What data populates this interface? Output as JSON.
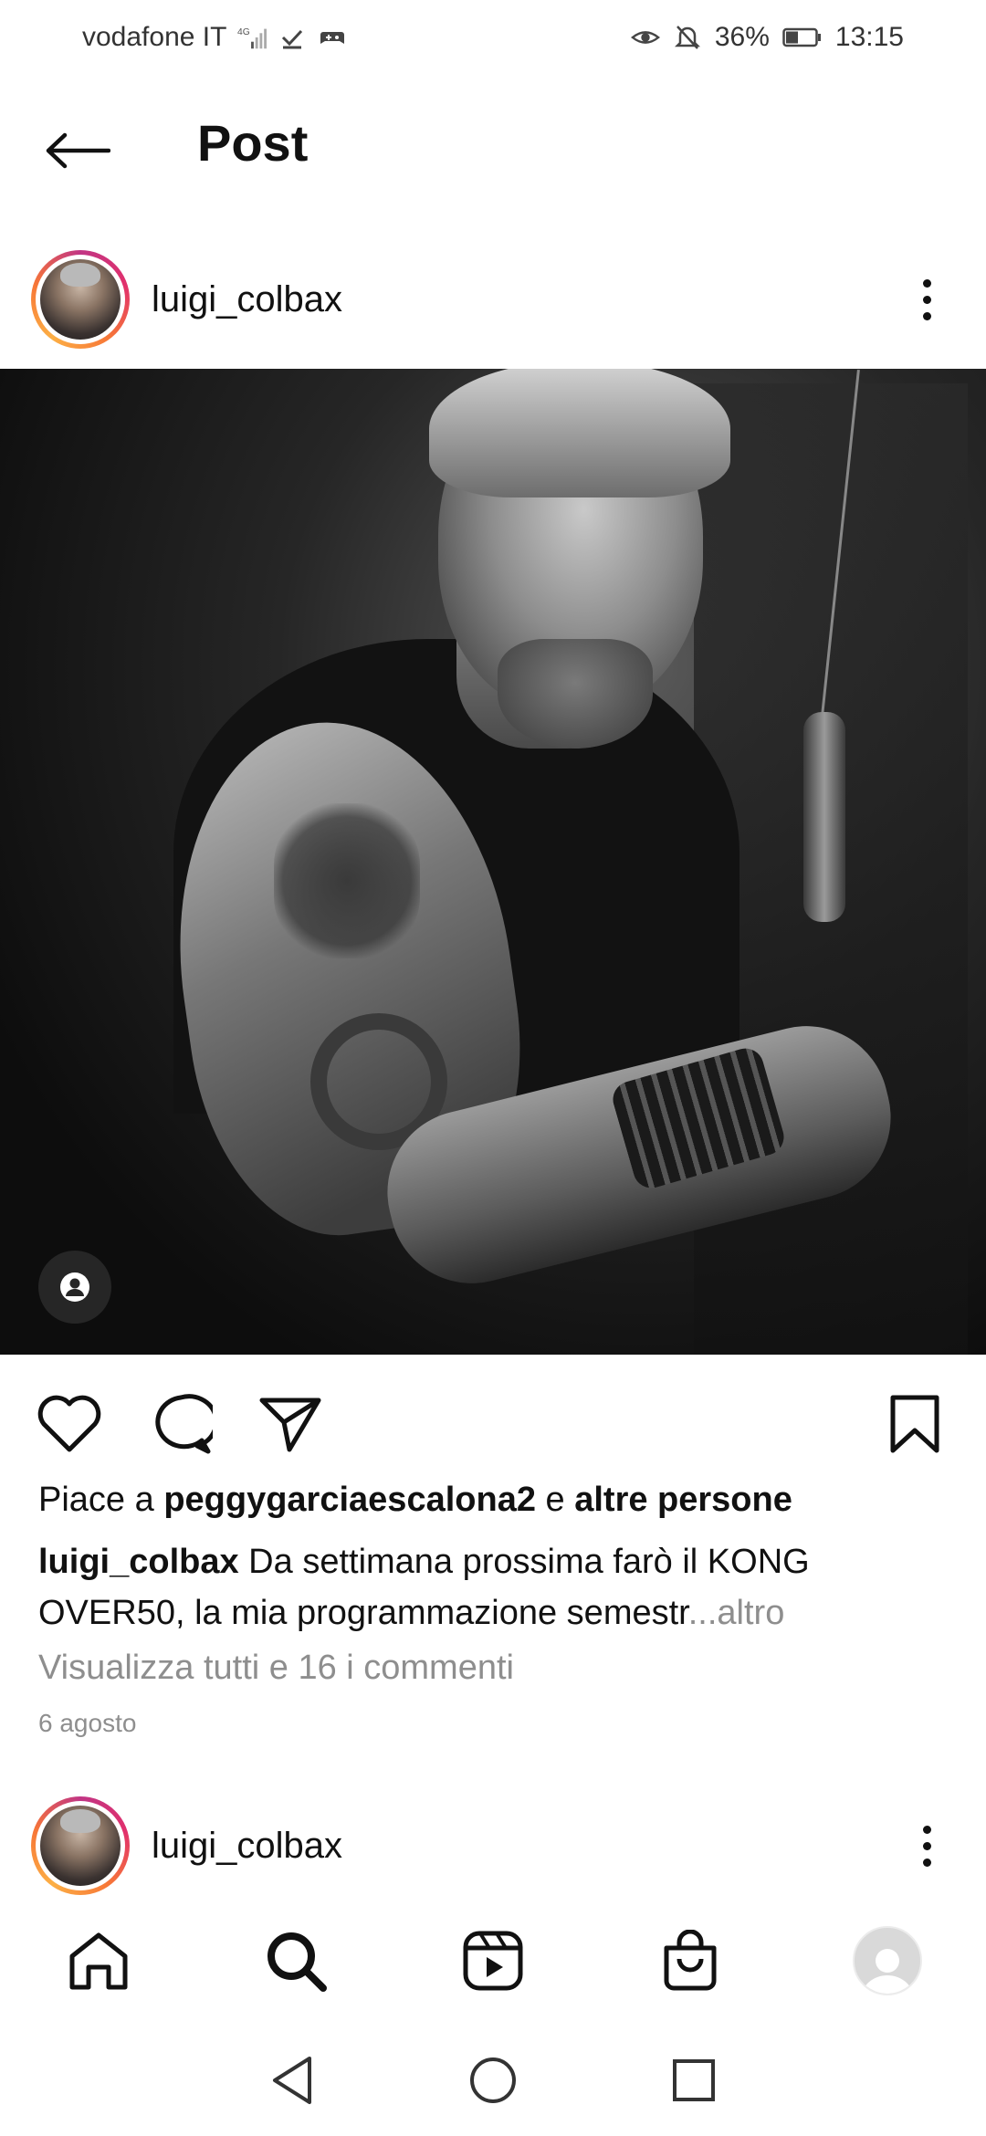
{
  "status_bar": {
    "carrier": "vodafone IT",
    "network": "4G",
    "battery": "36%",
    "time": "13:15",
    "icons": [
      "signal-icon",
      "check-icon",
      "game-icon",
      "eye-icon",
      "bell-off-icon",
      "battery-icon"
    ]
  },
  "header": {
    "title": "Post"
  },
  "post": {
    "username": "luigi_colbax",
    "likes": {
      "prefix": "Piace a ",
      "liker": "peggygarciaescalona2",
      "conjunction": " e ",
      "others": "altre persone"
    },
    "caption": {
      "username": "luigi_colbax",
      "text": " Da settimana prossima farò il KONG OVER50, la mia programmazione semestr",
      "more": "...altro"
    },
    "view_comments": "Visualizza tutti e 16 i commenti",
    "date": "6 agosto"
  },
  "next_post": {
    "username": "luigi_colbax"
  },
  "bottom_nav": [
    "home-icon",
    "search-icon",
    "reels-icon",
    "shop-icon",
    "profile-avatar"
  ],
  "colors": {
    "text": "#111111",
    "secondary": "#8e8e8e",
    "story_ring": [
      "#c13584",
      "#e1306c",
      "#f77737",
      "#fcaf45"
    ]
  }
}
